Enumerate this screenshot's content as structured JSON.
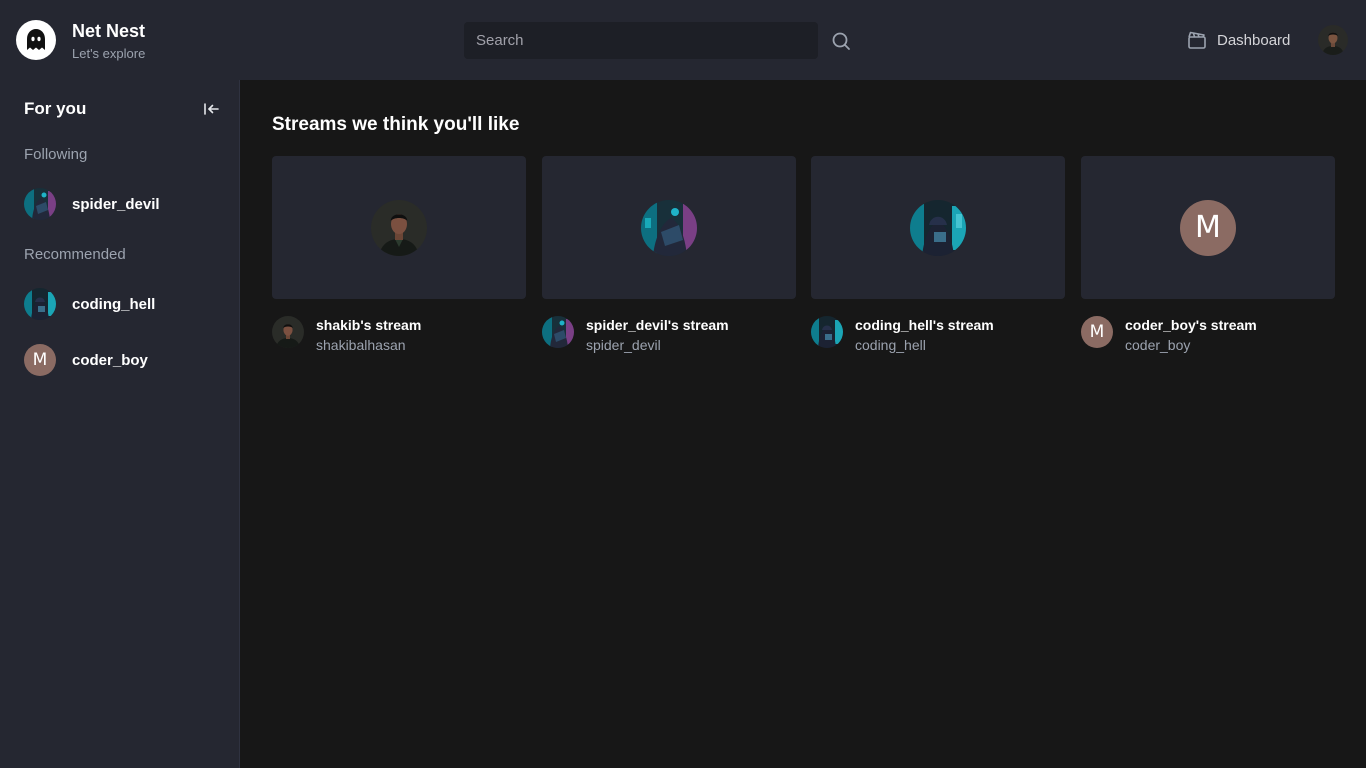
{
  "app": {
    "name": "Net Nest",
    "tagline": "Let's explore"
  },
  "header": {
    "search_placeholder": "Search",
    "dashboard_label": "Dashboard"
  },
  "sidebar": {
    "title": "For you",
    "following_label": "Following",
    "recommended_label": "Recommended",
    "following": [
      {
        "name": "spider_devil",
        "avatar": "cyber-neon"
      }
    ],
    "recommended": [
      {
        "name": "coding_hell",
        "avatar": "cyber-neon-hooded"
      },
      {
        "name": "coder_boy",
        "avatar": "letter",
        "initial": "M"
      }
    ]
  },
  "main": {
    "section_title": "Streams we think you'll like",
    "streams": [
      {
        "title": "shakib's stream",
        "username": "shakibalhasan",
        "avatar": "photo-person"
      },
      {
        "title": "spider_devil's stream",
        "username": "spider_devil",
        "avatar": "cyber-neon"
      },
      {
        "title": "coding_hell's stream",
        "username": "coding_hell",
        "avatar": "cyber-neon-hooded"
      },
      {
        "title": "coder_boy's stream",
        "username": "coder_boy",
        "avatar": "letter",
        "initial": "M"
      }
    ]
  },
  "colors": {
    "header_bg": "#252731",
    "page_bg": "#171717",
    "letter_avatar_bg": "#8b6b63",
    "muted_text": "#9ca3af"
  }
}
